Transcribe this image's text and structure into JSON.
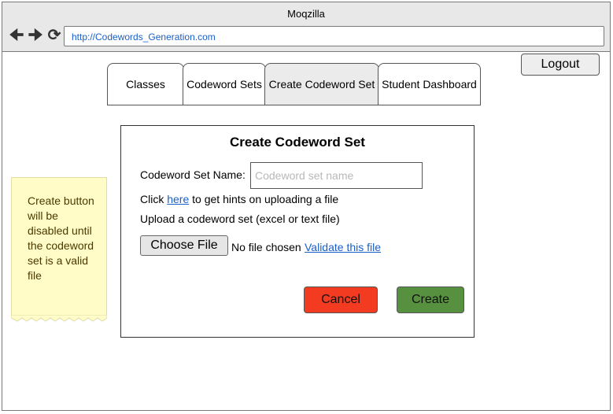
{
  "browser": {
    "title": "Moqzilla",
    "url": "http://Codewords_Generation.com",
    "nav_icons": [
      "back-arrow-icon",
      "forward-arrow-icon",
      "refresh-icon"
    ]
  },
  "header": {
    "logout_label": "Logout"
  },
  "tabs": [
    {
      "label": "Classes",
      "active": false
    },
    {
      "label": "Codeword Sets",
      "active": false
    },
    {
      "label": "Create Codeword Set",
      "active": true
    },
    {
      "label": "Student Dashboard",
      "active": false
    }
  ],
  "note": {
    "text": "Create button will be disabled until the codeword set is a valid file",
    "color": "#fffcc8"
  },
  "dialog": {
    "title": "Create Codeword Set",
    "name_label": "Codeword Set Name:",
    "name_placeholder": "Codeword set name",
    "hint_prefix": "Click ",
    "hint_link": "here",
    "hint_suffix": " to get hints on uploading a file",
    "upload_label": "Upload a codeword set (excel or text file)",
    "choose_file_label": "Choose File",
    "no_file_text": "No file chosen",
    "validate_link": "Validate this file",
    "cancel_label": "Cancel",
    "create_label": "Create",
    "cancel_color": "#f33b22",
    "create_color": "#57903f"
  }
}
